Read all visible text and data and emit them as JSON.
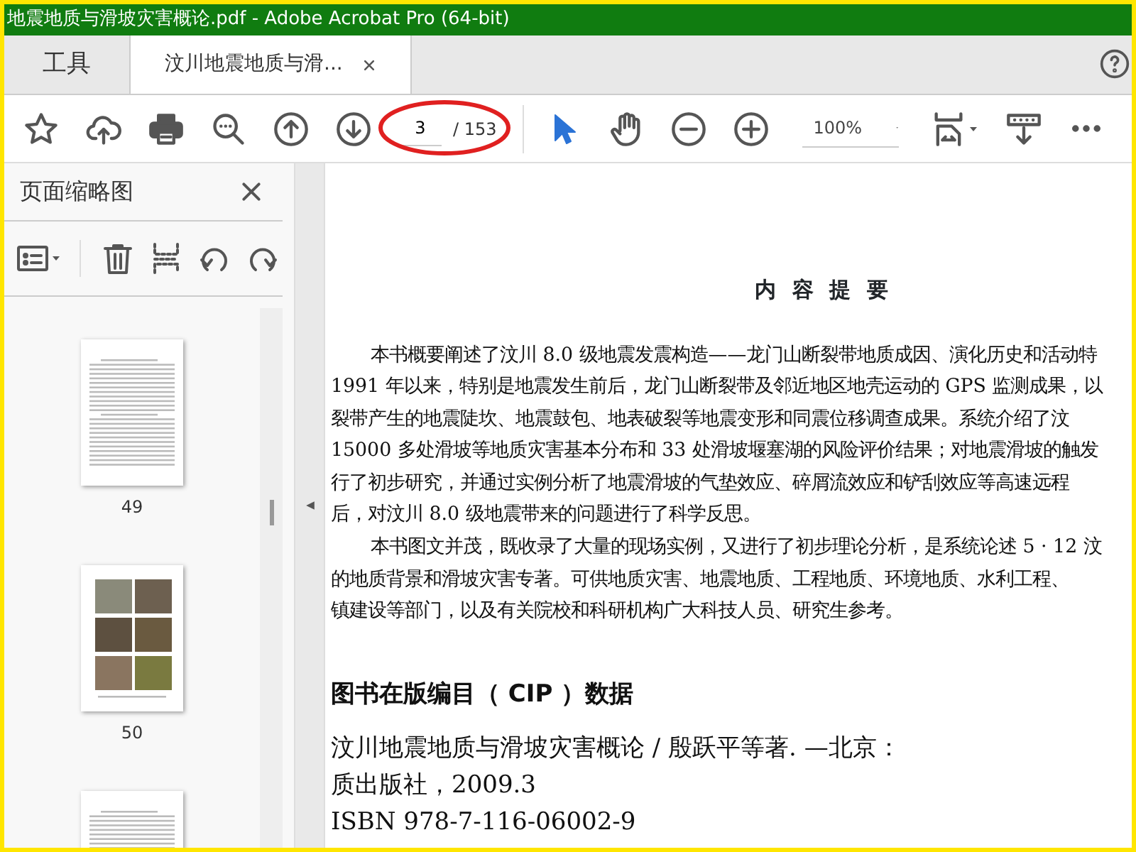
{
  "window": {
    "title": "地震地质与滑坡灾害概论.pdf - Adobe Acrobat Pro (64-bit)"
  },
  "tabs": [
    {
      "label": "工具",
      "selected": false,
      "closable": false
    },
    {
      "label": "汶川地震地质与滑...",
      "selected": true,
      "closable": true
    }
  ],
  "toolbar": {
    "page_number": "3",
    "page_count": "/ 153",
    "zoom": "100%"
  },
  "sidebar": {
    "title": "页面缩略图",
    "thumbnails": [
      {
        "kind": "text",
        "label": "49"
      },
      {
        "kind": "photos",
        "label": "50"
      },
      {
        "kind": "text"
      }
    ]
  },
  "document": {
    "heading": "内 容 提 要",
    "lines": [
      {
        "text": "本书概要阐述了汶川 8.0 级地震发震构造——龙门山断裂带地质成因、演化历史和活动特",
        "indent": true
      },
      {
        "text": "1991 年以来，特别是地震发生前后，龙门山断裂带及邻近地区地壳运动的 GPS 监测成果，以",
        "indent": false
      },
      {
        "text": "裂带产生的地震陡坎、地震鼓包、地表破裂等地震变形和同震位移调查成果。系统介绍了汶",
        "indent": false
      },
      {
        "text": "15000 多处滑坡等地质灾害基本分布和 33 处滑坡堰塞湖的风险评价结果；对地震滑坡的触发",
        "indent": false
      },
      {
        "text": "行了初步研究，并通过实例分析了地震滑坡的气垫效应、碎屑流效应和铲刮效应等高速远程",
        "indent": false
      },
      {
        "text": "后，对汶川 8.0 级地震带来的问题进行了科学反思。",
        "indent": false
      },
      {
        "text": "本书图文并茂，既收录了大量的现场实例，又进行了初步理论分析，是系统论述 5 · 12 汶",
        "indent": true
      },
      {
        "text": "的地质背景和滑坡灾害专著。可供地质灾害、地震地质、工程地质、环境地质、水利工程、",
        "indent": false
      },
      {
        "text": "镇建设等部门，以及有关院校和科研机构广大科技人员、研究生参考。",
        "indent": false
      }
    ],
    "cip_heading": "图书在版编目（ CIP ）数据",
    "cip_lines": [
      "汶川地震地质与滑坡灾害概论 / 殷跃平等著. —北京：",
      "质出版社，2009.3",
      "ISBN 978-7-116-06002-9"
    ]
  }
}
